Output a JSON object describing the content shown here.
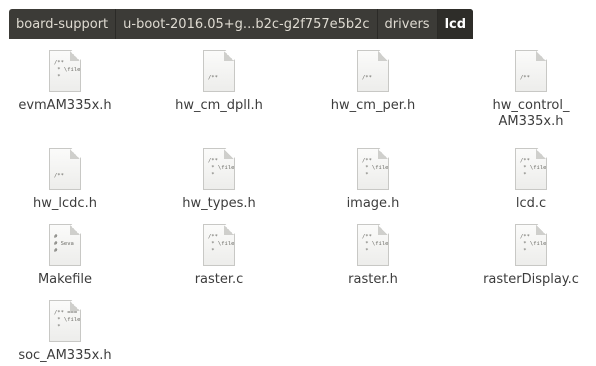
{
  "breadcrumbs": [
    {
      "label": "board-support"
    },
    {
      "label": "u-boot-2016.05+g...b2c-g2f757e5b2c"
    },
    {
      "label": "drivers"
    },
    {
      "label": "lcd"
    }
  ],
  "files": [
    {
      "name": "evmAM335x.h",
      "preview": "/**\n * \\file\n *"
    },
    {
      "name": "hw_cm_dpll.h",
      "preview": "/**"
    },
    {
      "name": "hw_cm_per.h",
      "preview": "/**"
    },
    {
      "name": "hw_control_\nAM335x.h",
      "preview": "/**"
    },
    {
      "name": "hw_lcdc.h",
      "preview": "/**"
    },
    {
      "name": "hw_types.h",
      "preview": "/**\n * \\file\n *"
    },
    {
      "name": "image.h",
      "preview": "/**\n * \\file\n *"
    },
    {
      "name": "lcd.c",
      "preview": "/**\n * \\file\n *"
    },
    {
      "name": "Makefile",
      "preview": "#\n# Seva\n#"
    },
    {
      "name": "raster.c",
      "preview": "/**\n * \\file\n *"
    },
    {
      "name": "raster.h",
      "preview": "/**\n * \\file\n *"
    },
    {
      "name": "rasterDisplay.c",
      "preview": "/**\n * \\file\n *"
    },
    {
      "name": "soc_AM335x.h",
      "preview": "/** ===\n * \\file\n *"
    }
  ]
}
